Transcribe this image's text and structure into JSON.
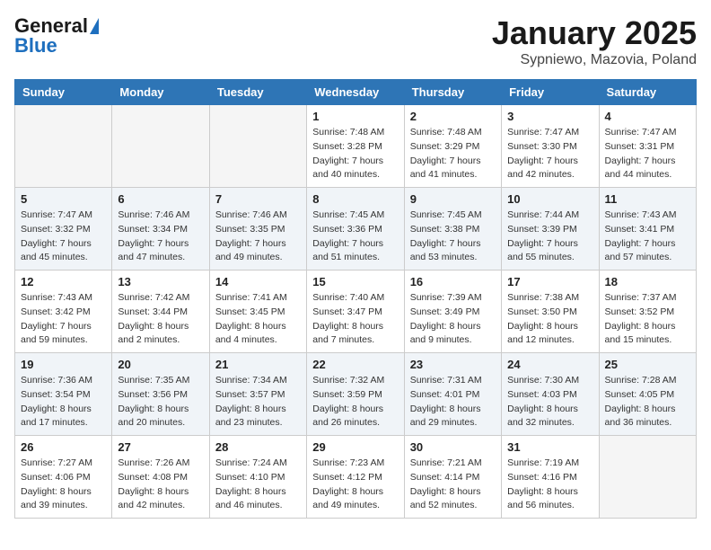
{
  "logo": {
    "general": "General",
    "blue": "Blue"
  },
  "title": "January 2025",
  "subtitle": "Sypniewo, Mazovia, Poland",
  "days_of_week": [
    "Sunday",
    "Monday",
    "Tuesday",
    "Wednesday",
    "Thursday",
    "Friday",
    "Saturday"
  ],
  "weeks": [
    [
      {
        "day": "",
        "info": ""
      },
      {
        "day": "",
        "info": ""
      },
      {
        "day": "",
        "info": ""
      },
      {
        "day": "1",
        "info": "Sunrise: 7:48 AM\nSunset: 3:28 PM\nDaylight: 7 hours\nand 40 minutes."
      },
      {
        "day": "2",
        "info": "Sunrise: 7:48 AM\nSunset: 3:29 PM\nDaylight: 7 hours\nand 41 minutes."
      },
      {
        "day": "3",
        "info": "Sunrise: 7:47 AM\nSunset: 3:30 PM\nDaylight: 7 hours\nand 42 minutes."
      },
      {
        "day": "4",
        "info": "Sunrise: 7:47 AM\nSunset: 3:31 PM\nDaylight: 7 hours\nand 44 minutes."
      }
    ],
    [
      {
        "day": "5",
        "info": "Sunrise: 7:47 AM\nSunset: 3:32 PM\nDaylight: 7 hours\nand 45 minutes."
      },
      {
        "day": "6",
        "info": "Sunrise: 7:46 AM\nSunset: 3:34 PM\nDaylight: 7 hours\nand 47 minutes."
      },
      {
        "day": "7",
        "info": "Sunrise: 7:46 AM\nSunset: 3:35 PM\nDaylight: 7 hours\nand 49 minutes."
      },
      {
        "day": "8",
        "info": "Sunrise: 7:45 AM\nSunset: 3:36 PM\nDaylight: 7 hours\nand 51 minutes."
      },
      {
        "day": "9",
        "info": "Sunrise: 7:45 AM\nSunset: 3:38 PM\nDaylight: 7 hours\nand 53 minutes."
      },
      {
        "day": "10",
        "info": "Sunrise: 7:44 AM\nSunset: 3:39 PM\nDaylight: 7 hours\nand 55 minutes."
      },
      {
        "day": "11",
        "info": "Sunrise: 7:43 AM\nSunset: 3:41 PM\nDaylight: 7 hours\nand 57 minutes."
      }
    ],
    [
      {
        "day": "12",
        "info": "Sunrise: 7:43 AM\nSunset: 3:42 PM\nDaylight: 7 hours\nand 59 minutes."
      },
      {
        "day": "13",
        "info": "Sunrise: 7:42 AM\nSunset: 3:44 PM\nDaylight: 8 hours\nand 2 minutes."
      },
      {
        "day": "14",
        "info": "Sunrise: 7:41 AM\nSunset: 3:45 PM\nDaylight: 8 hours\nand 4 minutes."
      },
      {
        "day": "15",
        "info": "Sunrise: 7:40 AM\nSunset: 3:47 PM\nDaylight: 8 hours\nand 7 minutes."
      },
      {
        "day": "16",
        "info": "Sunrise: 7:39 AM\nSunset: 3:49 PM\nDaylight: 8 hours\nand 9 minutes."
      },
      {
        "day": "17",
        "info": "Sunrise: 7:38 AM\nSunset: 3:50 PM\nDaylight: 8 hours\nand 12 minutes."
      },
      {
        "day": "18",
        "info": "Sunrise: 7:37 AM\nSunset: 3:52 PM\nDaylight: 8 hours\nand 15 minutes."
      }
    ],
    [
      {
        "day": "19",
        "info": "Sunrise: 7:36 AM\nSunset: 3:54 PM\nDaylight: 8 hours\nand 17 minutes."
      },
      {
        "day": "20",
        "info": "Sunrise: 7:35 AM\nSunset: 3:56 PM\nDaylight: 8 hours\nand 20 minutes."
      },
      {
        "day": "21",
        "info": "Sunrise: 7:34 AM\nSunset: 3:57 PM\nDaylight: 8 hours\nand 23 minutes."
      },
      {
        "day": "22",
        "info": "Sunrise: 7:32 AM\nSunset: 3:59 PM\nDaylight: 8 hours\nand 26 minutes."
      },
      {
        "day": "23",
        "info": "Sunrise: 7:31 AM\nSunset: 4:01 PM\nDaylight: 8 hours\nand 29 minutes."
      },
      {
        "day": "24",
        "info": "Sunrise: 7:30 AM\nSunset: 4:03 PM\nDaylight: 8 hours\nand 32 minutes."
      },
      {
        "day": "25",
        "info": "Sunrise: 7:28 AM\nSunset: 4:05 PM\nDaylight: 8 hours\nand 36 minutes."
      }
    ],
    [
      {
        "day": "26",
        "info": "Sunrise: 7:27 AM\nSunset: 4:06 PM\nDaylight: 8 hours\nand 39 minutes."
      },
      {
        "day": "27",
        "info": "Sunrise: 7:26 AM\nSunset: 4:08 PM\nDaylight: 8 hours\nand 42 minutes."
      },
      {
        "day": "28",
        "info": "Sunrise: 7:24 AM\nSunset: 4:10 PM\nDaylight: 8 hours\nand 46 minutes."
      },
      {
        "day": "29",
        "info": "Sunrise: 7:23 AM\nSunset: 4:12 PM\nDaylight: 8 hours\nand 49 minutes."
      },
      {
        "day": "30",
        "info": "Sunrise: 7:21 AM\nSunset: 4:14 PM\nDaylight: 8 hours\nand 52 minutes."
      },
      {
        "day": "31",
        "info": "Sunrise: 7:19 AM\nSunset: 4:16 PM\nDaylight: 8 hours\nand 56 minutes."
      },
      {
        "day": "",
        "info": ""
      }
    ]
  ]
}
